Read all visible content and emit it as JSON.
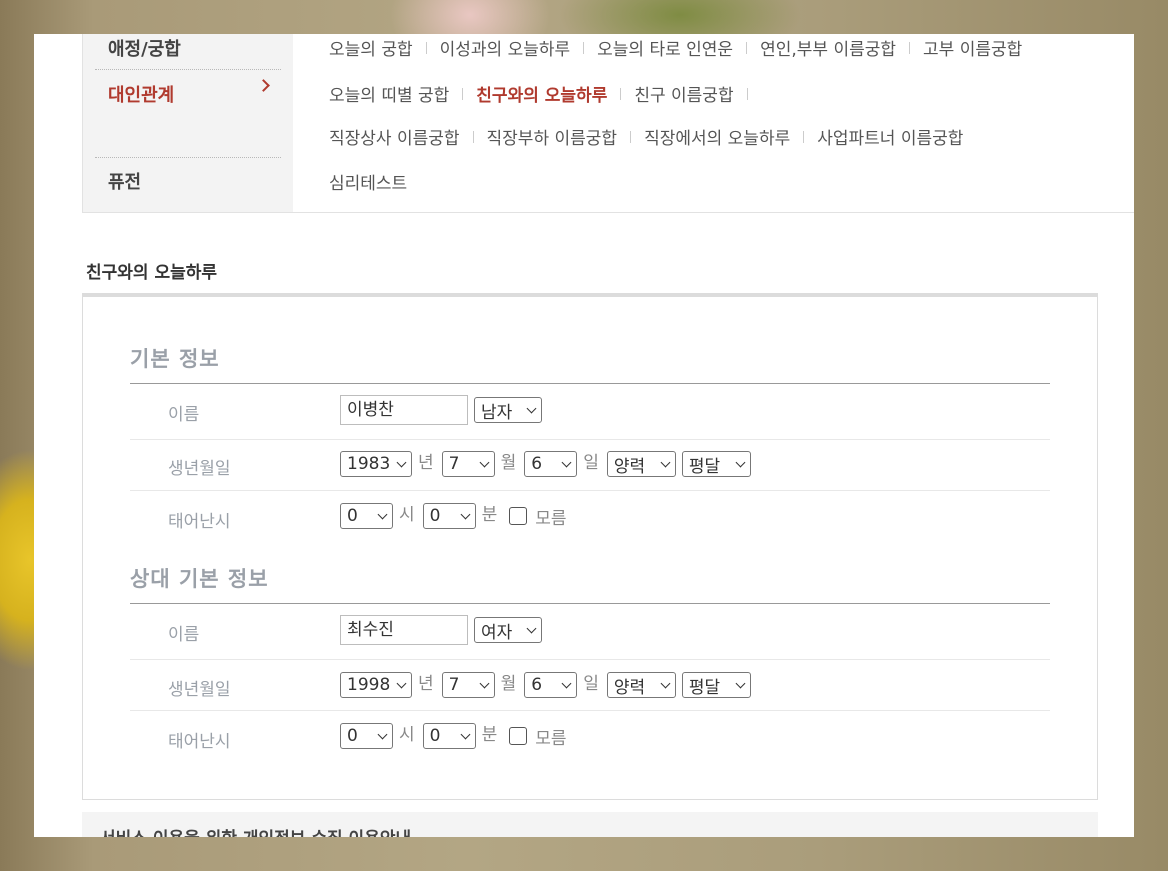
{
  "categories": [
    {
      "label": "애정/궁합",
      "active": false
    },
    {
      "label": "대인관계",
      "active": true
    },
    {
      "label": "퓨전",
      "active": false
    }
  ],
  "menu_rows": [
    [
      {
        "label": "오늘의 궁합",
        "active": false
      },
      {
        "label": "이성과의 오늘하루",
        "active": false
      },
      {
        "label": "오늘의 타로 인연운",
        "active": false
      },
      {
        "label": "연인,부부 이름궁합",
        "active": false
      },
      {
        "label": "고부 이름궁합",
        "active": false
      }
    ],
    [
      {
        "label": "오늘의 띠별 궁합",
        "active": false
      },
      {
        "label": "친구와의 오늘하루",
        "active": true
      },
      {
        "label": "친구 이름궁합",
        "active": false
      }
    ],
    [
      {
        "label": "직장상사 이름궁합",
        "active": false
      },
      {
        "label": "직장부하 이름궁합",
        "active": false
      },
      {
        "label": "직장에서의 오늘하루",
        "active": false
      },
      {
        "label": "사업파트너 이름궁합",
        "active": false
      }
    ],
    [
      {
        "label": "심리테스트",
        "active": false
      }
    ]
  ],
  "section_title": "친구와의 오늘하루",
  "groups": [
    {
      "title": "기본 정보",
      "name_label": "이름",
      "name_value": "이병찬",
      "gender": "남자",
      "birth_label": "생년월일",
      "year": "1983",
      "month": "7",
      "day": "6",
      "calendar": "양력",
      "leap": "평달",
      "time_label": "태어난시",
      "hour": "0",
      "minute": "0",
      "unknown_label": "모름"
    },
    {
      "title": "상대 기본 정보",
      "name_label": "이름",
      "name_value": "최수진",
      "gender": "여자",
      "birth_label": "생년월일",
      "year": "1998",
      "month": "7",
      "day": "6",
      "calendar": "양력",
      "leap": "평달",
      "time_label": "태어난시",
      "hour": "0",
      "minute": "0",
      "unknown_label": "모름"
    }
  ],
  "units": {
    "year": "년",
    "month": "월",
    "day": "일",
    "hour": "시",
    "minute": "분"
  },
  "notice": "서비스 이용을 위한 개인정보 수집 이용안내",
  "colors": {
    "accent": "#b03a2e",
    "label": "#9aa0a8"
  }
}
